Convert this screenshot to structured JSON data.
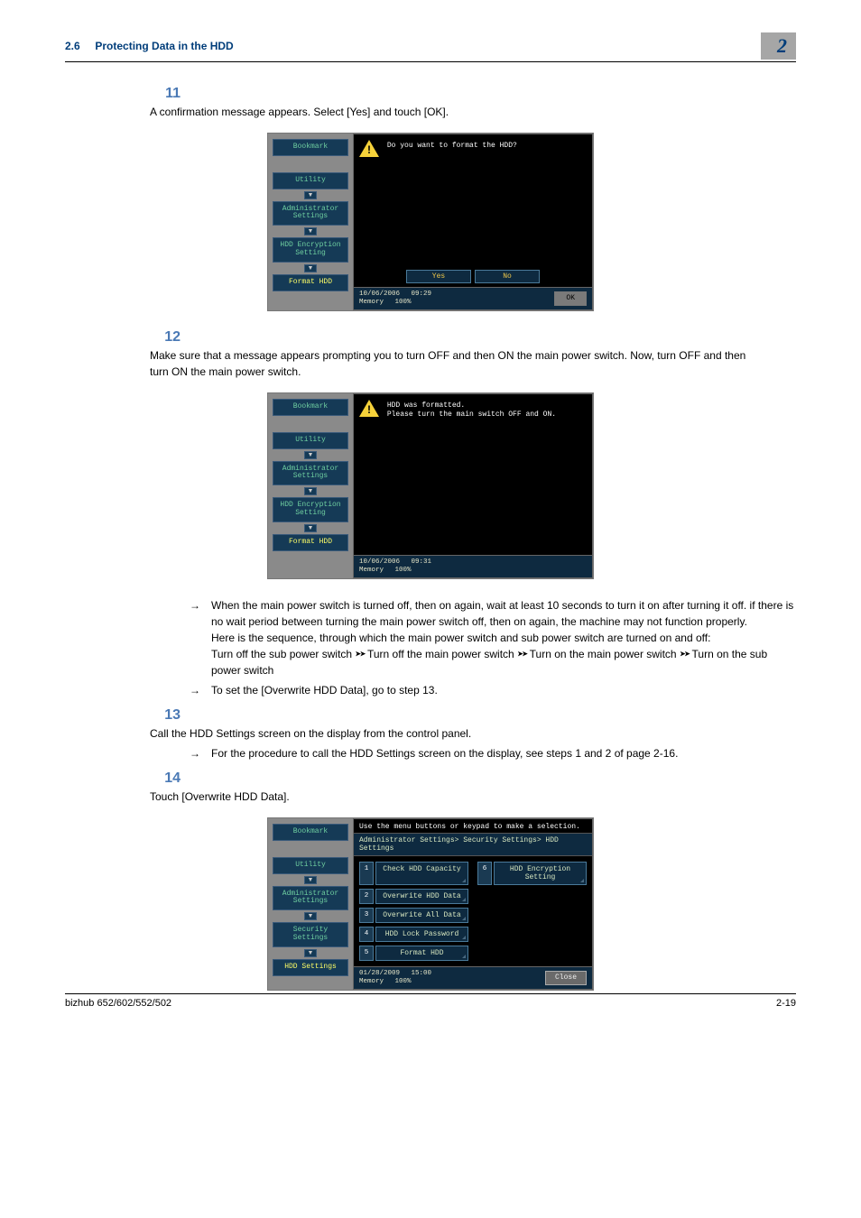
{
  "header": {
    "section_num": "2.6",
    "section_title": "Protecting Data in the HDD",
    "chapter_num": "2"
  },
  "steps": {
    "s11": {
      "num": "11",
      "text": "A confirmation message appears. Select [Yes] and touch [OK]."
    },
    "s12": {
      "num": "12",
      "text": "Make sure that a message appears prompting you to turn OFF and then ON the main power switch. Now, turn OFF and then turn ON the main power switch.",
      "bullets": [
        {
          "arrow": "→",
          "text": "When the main power switch is turned off, then on again, wait at least 10 seconds to turn it on after turning it off. if there is no wait period between turning the main power switch off, then on again, the machine may not function properly.\nHere is the sequence, through which the main power switch and sub power switch are turned on and off:\nTurn off the sub power switch ➤➤ Turn off the main power switch ➤➤ Turn on the main power switch ➤➤ Turn on the sub power switch"
        },
        {
          "arrow": "→",
          "text": "To set the [Overwrite HDD Data], go to step 13."
        }
      ]
    },
    "s13": {
      "num": "13",
      "text": "Call the HDD Settings screen on the display from the control panel.",
      "bullets": [
        {
          "arrow": "→",
          "text": "For the procedure to call the HDD Settings screen on the display, see steps 1 and 2 of page 2-16."
        }
      ]
    },
    "s14": {
      "num": "14",
      "text": "Touch [Overwrite HDD Data]."
    }
  },
  "panel1": {
    "sidebar": {
      "bookmark": "Bookmark",
      "items": [
        "Utility",
        "Administrator Settings",
        "HDD Encryption Setting",
        "Format HDD"
      ],
      "active_idx": 3
    },
    "message": "Do you want to format the HDD?",
    "yes": "Yes",
    "no": "No",
    "ok": "OK",
    "status": {
      "date": "10/06/2006",
      "time": "09:29",
      "mem_label": "Memory",
      "mem_val": "100%"
    }
  },
  "panel2": {
    "sidebar": {
      "bookmark": "Bookmark",
      "items": [
        "Utility",
        "Administrator Settings",
        "HDD Encryption Setting",
        "Format HDD"
      ],
      "active_idx": 3
    },
    "message_l1": "HDD was formatted.",
    "message_l2": "Please turn the main switch OFF and ON.",
    "status": {
      "date": "10/06/2006",
      "time": "09:31",
      "mem_label": "Memory",
      "mem_val": "100%"
    }
  },
  "panel3": {
    "sidebar": {
      "bookmark": "Bookmark",
      "items": [
        "Utility",
        "Administrator Settings",
        "Security Settings",
        "HDD Settings"
      ],
      "active_idx": 3
    },
    "header": "Use the menu buttons or keypad to make a selection.",
    "crumb": "Administrator Settings> Security Settings> HDD Settings",
    "options": [
      {
        "n": "1",
        "label": "Check HDD Capacity"
      },
      {
        "n": "2",
        "label": "Overwrite HDD Data"
      },
      {
        "n": "3",
        "label": "Overwrite All Data"
      },
      {
        "n": "4",
        "label": "HDD Lock Password"
      },
      {
        "n": "5",
        "label": "Format HDD"
      },
      {
        "n": "6",
        "label": "HDD Encryption Setting"
      }
    ],
    "close": "Close",
    "status": {
      "date": "01/28/2009",
      "time": "15:00",
      "mem_label": "Memory",
      "mem_val": "100%"
    }
  },
  "footer": {
    "left": "bizhub 652/602/552/502",
    "right": "2-19"
  }
}
